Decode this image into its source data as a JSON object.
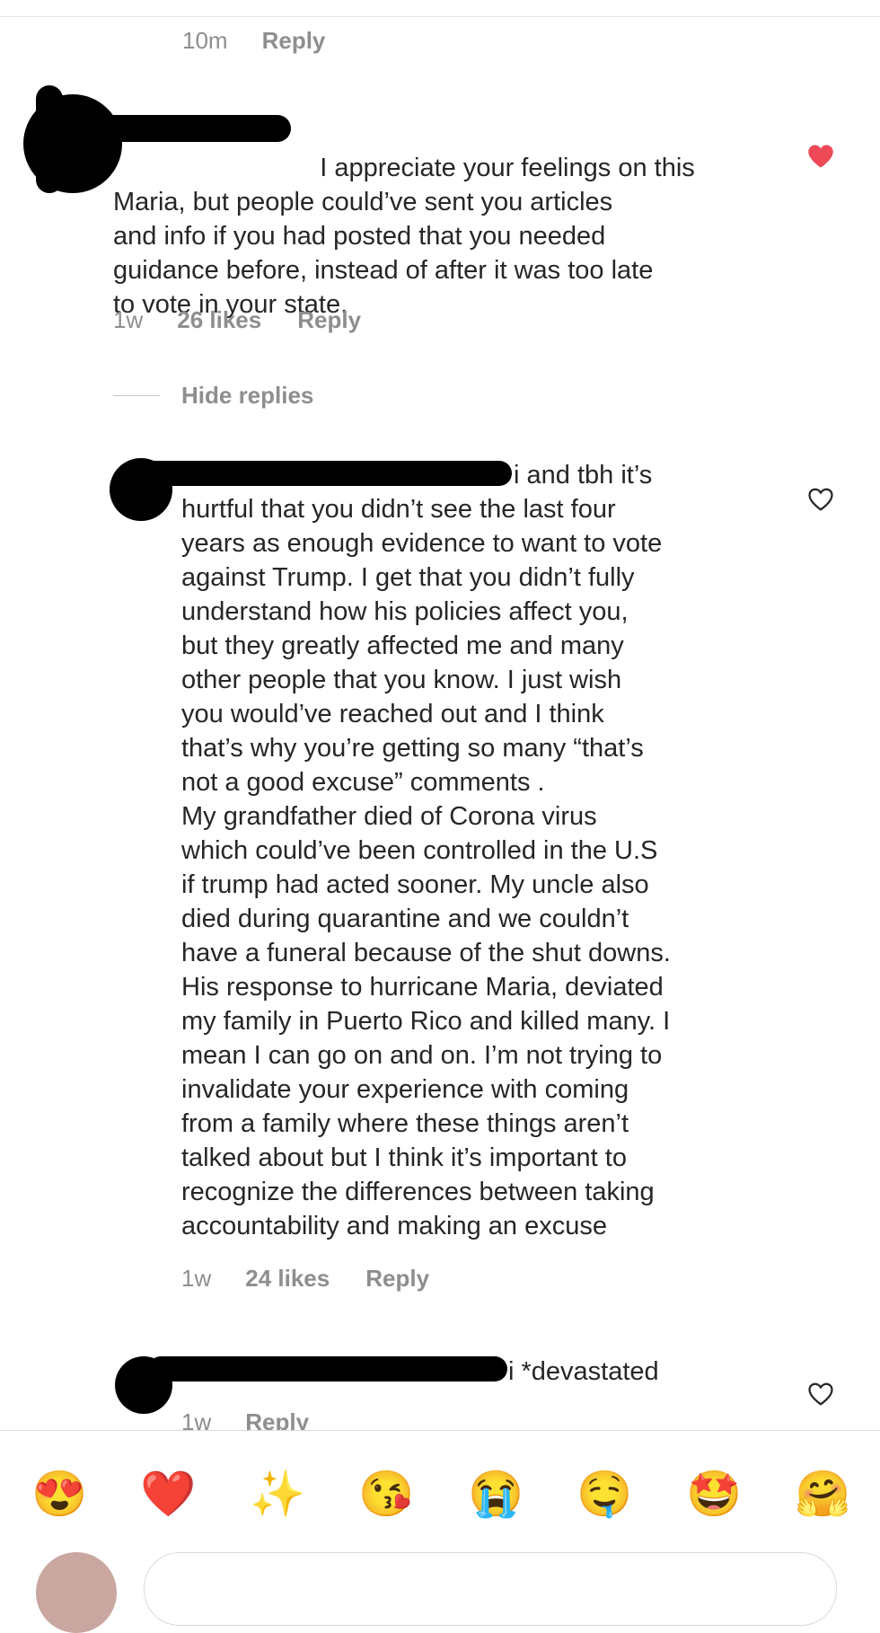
{
  "top_meta": {
    "time": "10m",
    "reply": "Reply"
  },
  "comments": [
    {
      "username_visible": "",
      "text": "I appreciate your feelings on this\nMaria, but people could’ve sent you articles\nand info if you had posted that you needed\nguidance before, instead of after it was too late\nto vote in your state.",
      "time": "1w",
      "likes": "26 likes",
      "reply": "Reply",
      "liked": true
    },
    {
      "username_visible": "",
      "first_line_tail": "i and tbh it’s",
      "text": "hurtful that you didn’t see the last four\nyears as enough evidence to want to vote\nagainst Trump. I get that you didn’t fully\nunderstand how his policies affect you,\nbut they greatly affected me and many\nother people that you know. I just wish\nyou would’ve reached out and I think\nthat’s why you’re getting so many “that’s\nnot a good excuse” comments .\nMy grandfather died of Corona virus\nwhich could’ve been controlled in the U.S\nif trump had acted sooner. My uncle also\ndied during quarantine and we couldn’t\nhave a funeral because of the shut downs.\nHis response to hurricane Maria, deviated\nmy family in Puerto Rico and killed many. I\nmean I can go on and on. I’m not trying to\ninvalidate your experience with coming\nfrom a family where these things aren’t\ntalked about but I think it’s important to\nrecognize the differences between taking\naccountability and making an excuse",
      "time": "1w",
      "likes": "24 likes",
      "reply": "Reply",
      "liked": false
    },
    {
      "username_visible": "",
      "first_line_tail": "i *devastated",
      "time": "1w",
      "reply": "Reply",
      "liked": false
    }
  ],
  "hide_replies": "Hide replies",
  "emoji_bar": [
    {
      "name": "heart-eyes-emoji",
      "glyph": "😍"
    },
    {
      "name": "red-heart-emoji",
      "glyph": "❤️"
    },
    {
      "name": "sparkles-emoji",
      "glyph": "✨"
    },
    {
      "name": "kissing-face-emoji",
      "glyph": "😘"
    },
    {
      "name": "crying-face-emoji",
      "glyph": "😭"
    },
    {
      "name": "drooling-face-emoji",
      "glyph": "🤤"
    },
    {
      "name": "star-struck-emoji",
      "glyph": "🤩"
    },
    {
      "name": "hugging-face-emoji",
      "glyph": "🤗"
    }
  ],
  "colors": {
    "liked_heart": "#ed4956",
    "meta": "#8e8e8e",
    "mention": "#00376b"
  }
}
